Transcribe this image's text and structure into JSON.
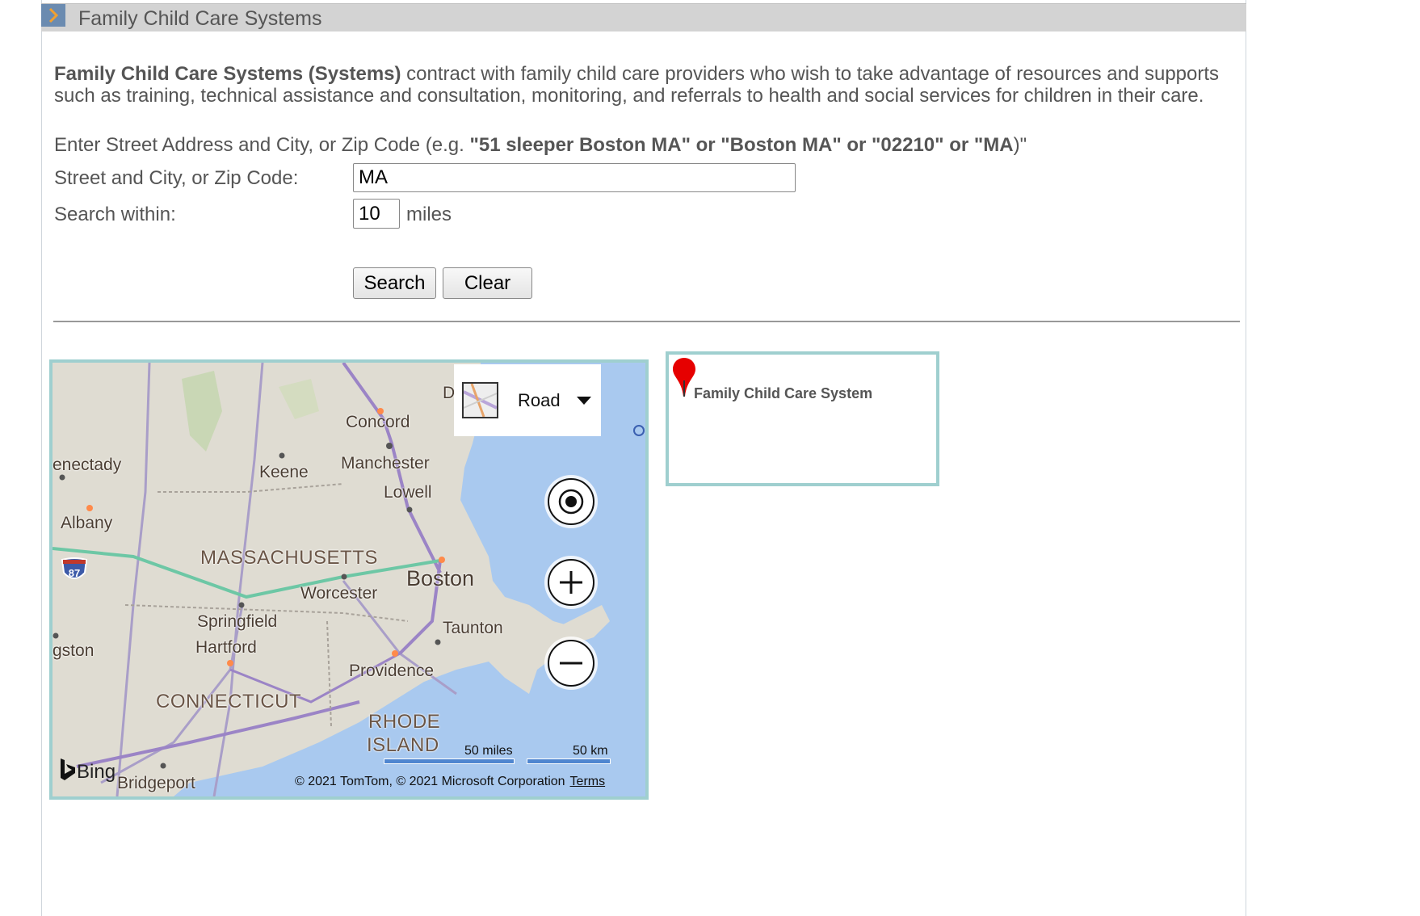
{
  "header": {
    "title": "Family Child Care Systems",
    "toggle_icon": "chevron-right-icon"
  },
  "description": {
    "bold": "Family Child Care Systems (Systems)",
    "rest": " contract with family child care providers who wish to take advantage of resources and supports such as training, technical assistance and consultation, monitoring, and referrals to health and social services for children in their care."
  },
  "hint": {
    "prefix": "Enter Street Address and City, or Zip Code (e.g. ",
    "examples": "\"51 sleeper Boston MA\" or \"Boston MA\" or \"02210\" or \"MA",
    "suffix": ")\""
  },
  "form": {
    "address_label": "Street and City, or Zip Code:",
    "address_value": "MA",
    "radius_label": "Search within:",
    "radius_value": "10",
    "radius_unit": "miles",
    "search_label": "Search",
    "clear_label": "Clear"
  },
  "map": {
    "type_label": "Road",
    "cities": {
      "concord": "Concord",
      "manchester": "Manchester",
      "keene": "Keene",
      "schenectady": "enectady",
      "lowell": "Lowell",
      "albany": "Albany",
      "worcester": "Worcester",
      "boston": "Boston",
      "springfield": "Springfield",
      "hartford": "Hartford",
      "taunton": "Taunton",
      "providence": "Providence",
      "kingston": "gston",
      "bridgeport": "Bridgeport",
      "d_cut": "D"
    },
    "states": {
      "massachusetts": "MASSACHUSETTS",
      "connecticut": "CONNECTICUT",
      "rhode1": "RHODE",
      "rhode2": "ISLAND"
    },
    "shield": "87",
    "scale_miles": "50 miles",
    "scale_km": "50 km",
    "copyright": "© 2021 TomTom, © 2021 Microsoft Corporation",
    "terms": "Terms",
    "logo": "Bing"
  },
  "legend": {
    "label": "Family Child Care System"
  },
  "colors": {
    "header_bg": "#d3d3d3",
    "header_toggle": "#6b8bb0",
    "map_border": "#9fcfcf",
    "water": "#a9c9ef",
    "pin": "#e60000"
  }
}
